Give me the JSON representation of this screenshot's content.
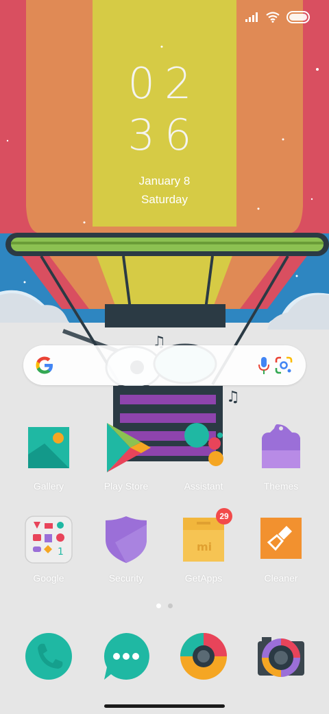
{
  "status_bar": {
    "icons": [
      "signal-icon",
      "wifi-icon",
      "battery-icon"
    ]
  },
  "clock": {
    "hour": "02",
    "minute": "36"
  },
  "date": {
    "line1": "January 8",
    "line2": "Saturday"
  },
  "search_bar": {
    "icons": [
      "google-logo-icon",
      "microphone-icon",
      "google-lens-icon"
    ]
  },
  "apps": [
    {
      "label": "Gallery",
      "icon": "gallery-icon"
    },
    {
      "label": "Play Store",
      "icon": "play-store-icon"
    },
    {
      "label": "Assistant",
      "icon": "assistant-icon"
    },
    {
      "label": "Themes",
      "icon": "themes-icon"
    },
    {
      "label": "Google",
      "icon": "google-folder-icon"
    },
    {
      "label": "Security",
      "icon": "security-shield-icon"
    },
    {
      "label": "GetApps",
      "icon": "getapps-box-icon",
      "badge": "29"
    },
    {
      "label": "Cleaner",
      "icon": "cleaner-brush-icon"
    }
  ],
  "dock": [
    {
      "icon": "phone-icon"
    },
    {
      "icon": "messages-icon"
    },
    {
      "icon": "browser-icon"
    },
    {
      "icon": "camera-icon"
    }
  ],
  "page_indicator": {
    "pages": 2,
    "active": 1
  },
  "colors": {
    "balloon_red": "#d94f60",
    "balloon_orange": "#e08a55",
    "balloon_yellow": "#d6cb45",
    "sky_blue": "#2e86c1",
    "ground": "#e6e6e6",
    "accent_teal": "#1fb8a3"
  }
}
